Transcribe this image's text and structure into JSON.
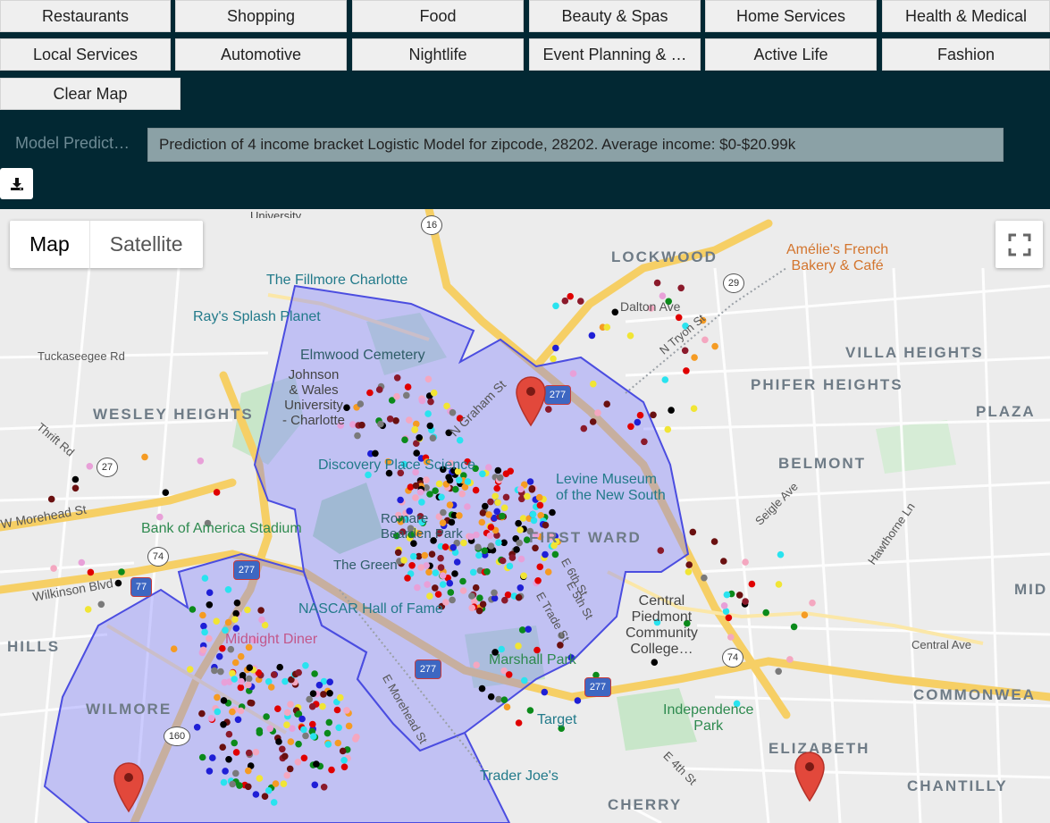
{
  "categories": {
    "row1": [
      "Restaurants",
      "Shopping",
      "Food",
      "Beauty & Spas",
      "Home Services",
      "Health & Medical"
    ],
    "row2": [
      "Local Services",
      "Automotive",
      "Nightlife",
      "Event Planning & …",
      "Active Life",
      "Fashion"
    ],
    "clear_label": "Clear Map"
  },
  "prediction": {
    "label": "Model Predict…",
    "text": "Prediction of 4 income bracket Logistic Model for zipcode, 28202. Average income: $0-$20.99k"
  },
  "map": {
    "type_control": {
      "map_label": "Map",
      "satellite_label": "Satellite",
      "selected": "Map"
    },
    "neighborhoods": [
      "LOCKWOOD",
      "VILLA HEIGHTS",
      "PHIFER HEIGHTS",
      "PLAZA",
      "WESLEY HEIGHTS",
      "BELMONT",
      "FIRST WARD",
      "HILLS",
      "WILMORE",
      "COMMONWEA",
      "ELIZABETH",
      "CHANTILLY",
      "CHERRY",
      "MID"
    ],
    "pois": {
      "fillmore": "The Fillmore Charlotte",
      "splash": "Ray's Splash Planet",
      "cemetery": "Elmwood Cemetery",
      "jwu": "Johnson\n& Wales\nUniversity\n- Charlotte",
      "discovery": "Discovery Place Science",
      "levine": "Levine Museum\nof the New South",
      "boa": "Bank of America Stadium",
      "romare": "Romare\nBearden Park",
      "green": "The Green",
      "nascar": "NASCAR Hall of Fame",
      "midnight": "Midnight Diner",
      "marshall": "Marshall Park",
      "cpcc": "Central\nPiedmont\nCommunity\nCollege…",
      "target": "Target",
      "independence": "Independence\nPark",
      "traderjoes": "Trader Joe's",
      "amelie": "Amélie's French\nBakery & Café",
      "university": "University"
    },
    "streets": {
      "tuckaseegee": "Tuckaseegee Rd",
      "thrift": "Thrift Rd",
      "wmorehead": "W Morehead St",
      "wilkinson": "Wilkinson Blvd",
      "dalton": "Dalton Ave",
      "ntryon": "N Tryon St",
      "ngraham": "N Graham St",
      "seigle": "Seigle Ave",
      "hawthorne": "Hawthorne Ln",
      "central": "Central Ave",
      "e6th": "E 6th St",
      "e5th": "E 5th St",
      "etrade": "E Trade St",
      "emorehead": "E Morehead St",
      "e4th": "E 4th St",
      "e6th2": "E 6th St"
    },
    "shields": [
      "16",
      "29",
      "27",
      "74",
      "77",
      "277",
      "277",
      "277",
      "277",
      "74",
      "160"
    ],
    "marker_count": 3,
    "zipcode_highlight": "28202"
  }
}
